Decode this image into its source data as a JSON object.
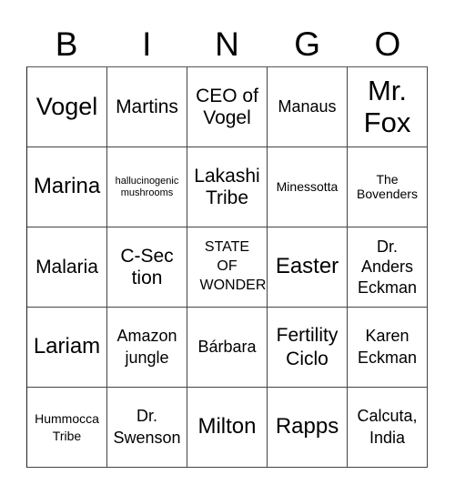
{
  "header": [
    "B",
    "I",
    "N",
    "G",
    "O"
  ],
  "board": [
    [
      "Vogel",
      "Martins",
      "CEO of Vogel",
      "Manaus",
      "Mr. Fox"
    ],
    [
      "Marina",
      "hallucinogenic mushrooms",
      "Lakashi Tribe",
      "Minessotta",
      "The Bovenders"
    ],
    [
      "Malaria",
      "C-Section",
      "STATE OF WONDER",
      "Easter",
      "Dr. Anders Eckman"
    ],
    [
      "Lariam",
      "Amazon jungle",
      "Bárbara",
      "Fertility Ciclo",
      "Karen Eckman"
    ],
    [
      "Hummocca Tribe",
      "Dr. Swenson",
      "Milton",
      "Rapps",
      "Calcuta, India"
    ]
  ]
}
